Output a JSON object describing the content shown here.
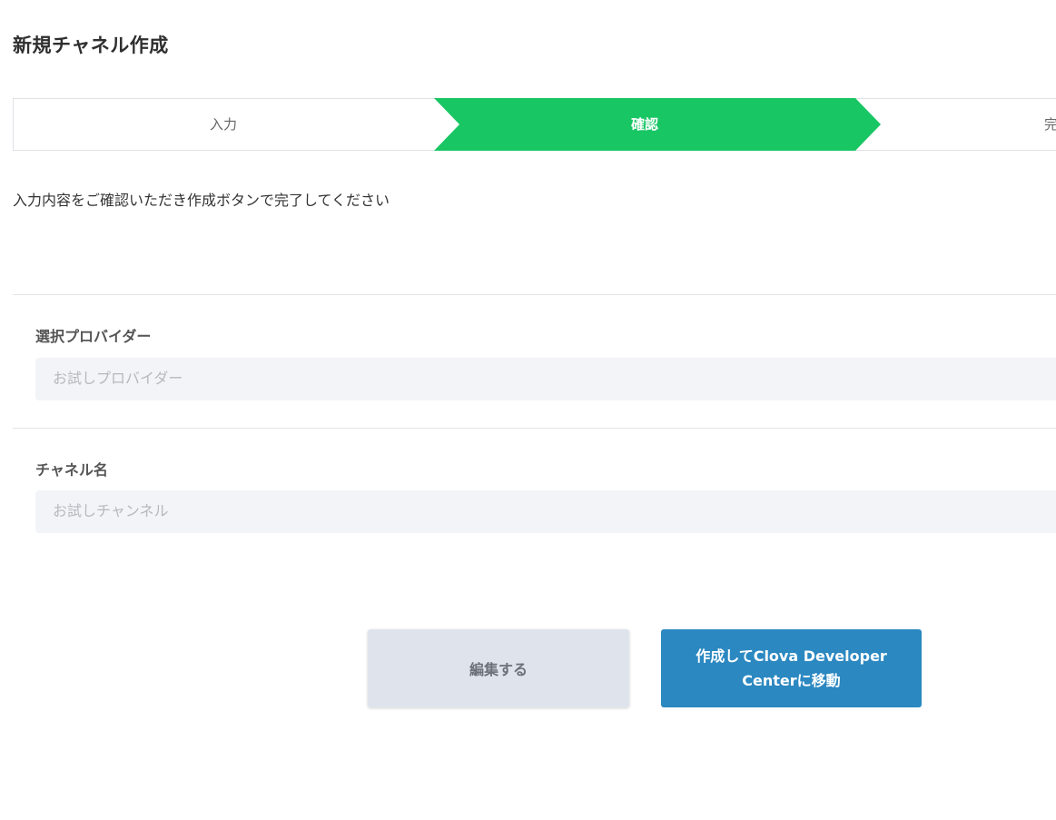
{
  "header": {
    "title": "新規チャネル作成"
  },
  "stepper": {
    "steps": [
      {
        "label": "入力",
        "state": "done"
      },
      {
        "label": "確認",
        "state": "active"
      },
      {
        "label": "完",
        "state": "pending"
      }
    ],
    "active_color": "#19c664",
    "border_color": "#dfe1e5"
  },
  "instruction": "入力内容をご確認いただき作成ボタンで完了してください",
  "fields": {
    "provider": {
      "label": "選択プロバイダー",
      "value": "お試しプロバイダー"
    },
    "channel_name": {
      "label": "チャネル名",
      "value": "お試しチャンネル"
    }
  },
  "actions": {
    "edit_label": "編集する",
    "create_label": "作成してClova Developer Centerに移動"
  },
  "colors": {
    "primary_button": "#2b88c1",
    "secondary_button": "#dfe4ec",
    "field_background": "#f2f4f7"
  }
}
